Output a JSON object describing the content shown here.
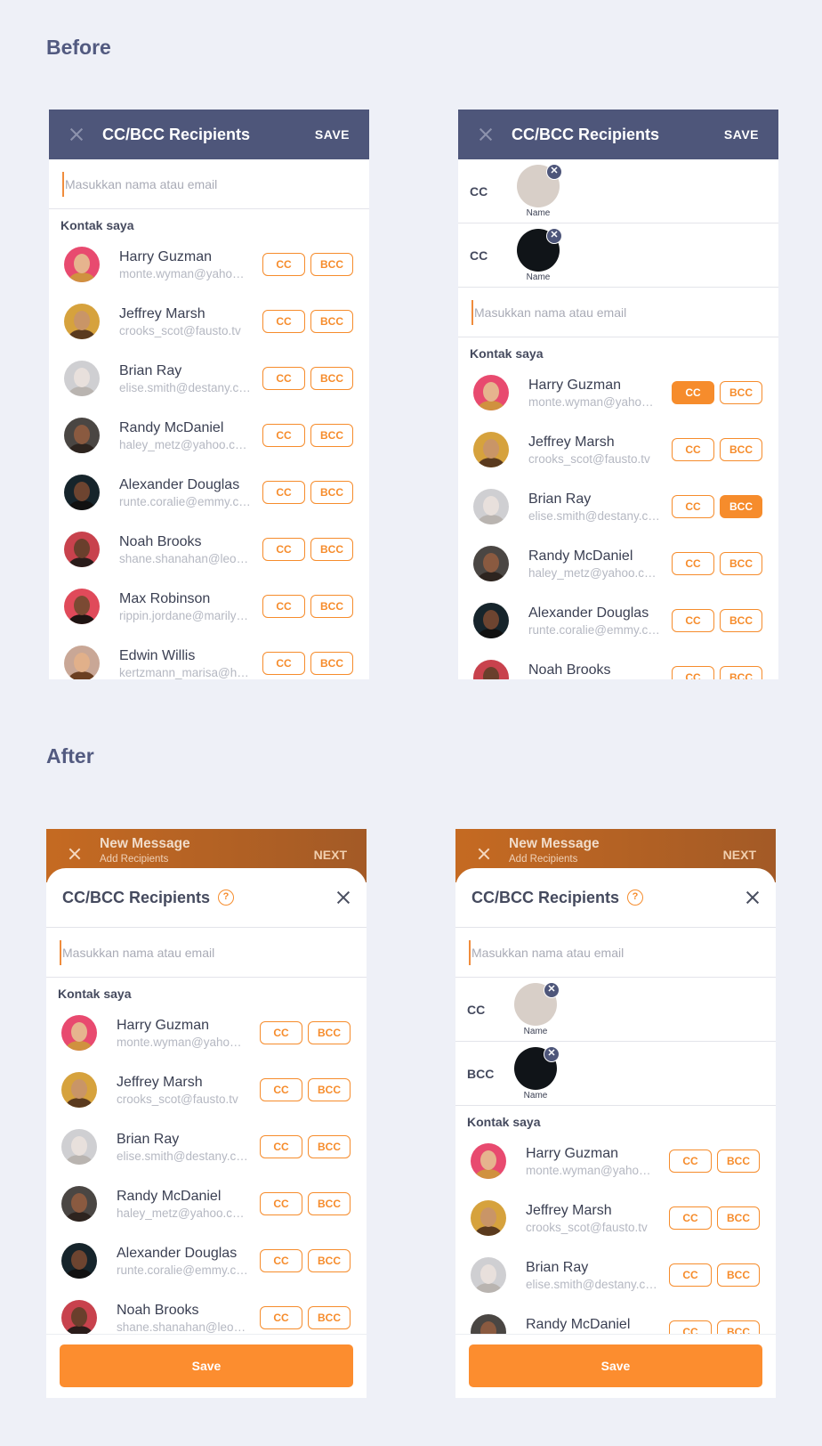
{
  "labels": {
    "before": "Before",
    "after": "After"
  },
  "topbar": {
    "title": "CC/BCC Recipients",
    "save": "SAVE"
  },
  "orangebar": {
    "title": "New Message",
    "subtitle": "Add Recipients",
    "next": "NEXT"
  },
  "sheet": {
    "title": "CC/BCC Recipients",
    "help": "?",
    "save": "Save"
  },
  "search": {
    "placeholder": "Masukkan nama atau email"
  },
  "section_label": "Kontak saya",
  "pill": {
    "cc": "CC",
    "bcc": "BCC",
    "remove": "✕"
  },
  "recipients_before": [
    {
      "label": "CC",
      "name": "Name"
    },
    {
      "label": "CC",
      "name": "Name"
    }
  ],
  "recipients_after": [
    {
      "label": "CC",
      "name": "Name"
    },
    {
      "label": "BCC",
      "name": "Name"
    }
  ],
  "contacts": [
    {
      "name": "Harry Guzman",
      "email": "monte.wyman@yahoo.com",
      "skin": "#e6b48e",
      "bg": "#e84a6f",
      "hair": "#d0913f"
    },
    {
      "name": "Jeffrey Marsh",
      "email": "crooks_scot@fausto.tv",
      "skin": "#c99567",
      "bg": "#d6a23d",
      "hair": "#5a3a1e"
    },
    {
      "name": "Brian Ray",
      "email": "elise.smith@destany.com",
      "skin": "#e8e0dc",
      "bg": "#cfcfd2",
      "hair": "#b9b4b0"
    },
    {
      "name": "Randy McDaniel",
      "email": "haley_metz@yahoo.com",
      "skin": "#8a5a40",
      "bg": "#4a4643",
      "hair": "#2d241f"
    },
    {
      "name": "Alexander Douglas",
      "email": "runte.coralie@emmy.com",
      "skin": "#6d4430",
      "bg": "#16242b",
      "hair": "#111"
    },
    {
      "name": "Noah Brooks",
      "email": "shane.shanahan@leopold.com",
      "skin": "#6a3f2c",
      "bg": "#c8424d",
      "hair": "#2a1c1a"
    },
    {
      "name": "Max Robinson",
      "email": "rippin.jordane@marilyne.com",
      "skin": "#7b4a33",
      "bg": "#e04a5a",
      "hair": "#1e1412"
    },
    {
      "name": "Edwin Willis",
      "email": "kertzmann_marisa@hotmail.com",
      "skin": "#e1b08a",
      "bg": "#c9a796",
      "hair": "#6b3f22"
    }
  ],
  "rec_faces": [
    {
      "skin": "#e3b38b",
      "bg": "#d8cfc8",
      "hair": "#6b3f22"
    },
    {
      "skin": "#5b3a2a",
      "bg": "#101418",
      "hair": "#111"
    }
  ]
}
